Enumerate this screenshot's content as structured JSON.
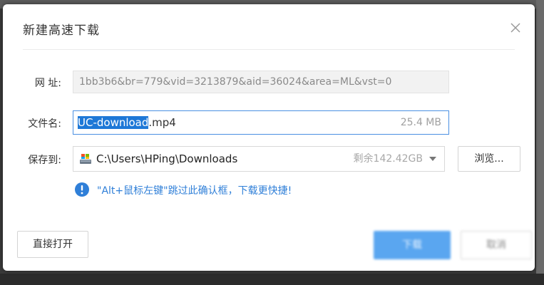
{
  "dialog": {
    "title": "新建高速下载",
    "close_icon": "close-icon"
  },
  "url_row": {
    "label": "网 址:",
    "value": "1bb3b6&br=779&vid=3213879&aid=36024&area=ML&vst=0"
  },
  "filename_row": {
    "label": "文件名:",
    "name_selected": "UC-download",
    "extension": ".mp4",
    "size": "25.4 MB"
  },
  "save_row": {
    "label": "保存到:",
    "path": "C:\\Users\\HPing\\Downloads",
    "free_space": "剩余142.42GB",
    "drive_icon": "drive-icon",
    "dropdown_icon": "chevron-down-icon",
    "browse_label": "浏览..."
  },
  "tip": {
    "icon": "info-icon",
    "text": "\"Alt+鼠标左键\"跳过此确认框，下载更快捷!"
  },
  "footer": {
    "direct_open_label": "直接打开",
    "download_label": "下载",
    "cancel_label": "取消"
  },
  "colors": {
    "accent": "#1e78d7",
    "tip_text": "#2f7fd8",
    "primary_button": "#5aa6f0",
    "focus_border": "#4a90e2"
  }
}
